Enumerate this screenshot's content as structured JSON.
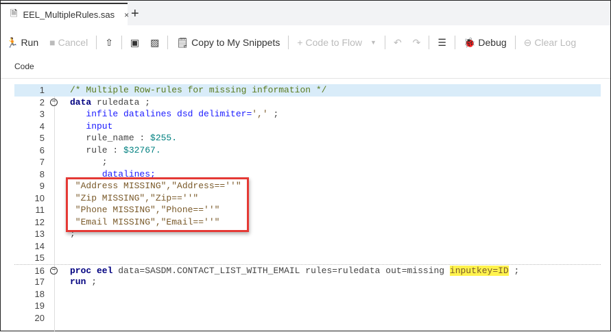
{
  "tab": {
    "title": "EEL_MultipleRules.sas",
    "close": "×",
    "new": "+"
  },
  "toolbar": {
    "run": "Run",
    "cancel": "Cancel",
    "copy_snippets": "Copy to My Snippets",
    "code_to_flow": "Code to Flow",
    "debug": "Debug",
    "clear_log": "Clear Log"
  },
  "code_tab": "Code",
  "lines": [
    [
      [
        "c",
        "/* Multiple Row-rules for missing information */"
      ]
    ],
    [
      [
        "k",
        "data"
      ],
      [
        "p",
        " ruledata ;"
      ]
    ],
    [
      [
        "p",
        "   "
      ],
      [
        "b",
        "infile datalines dsd delimiter="
      ],
      [
        "s",
        "','"
      ],
      [
        "p",
        " ;"
      ]
    ],
    [
      [
        "p",
        "   "
      ],
      [
        "b",
        "input"
      ]
    ],
    [
      [
        "p",
        "   rule_name : "
      ],
      [
        "n",
        "$255."
      ]
    ],
    [
      [
        "p",
        "   rule : "
      ],
      [
        "n",
        "$32767."
      ]
    ],
    [
      [
        "p",
        "      ;"
      ]
    ],
    [
      [
        "p",
        "      "
      ],
      [
        "b",
        "datalines;"
      ]
    ],
    [
      [
        "s",
        " \"Address MISSING\",\"Address==''\""
      ]
    ],
    [
      [
        "s",
        " \"Zip MISSING\",\"Zip==''\""
      ]
    ],
    [
      [
        "s",
        " \"Phone MISSING\",\"Phone==''\""
      ]
    ],
    [
      [
        "s",
        " \"Email MISSING\",\"Email==''\""
      ]
    ],
    [
      [
        "p",
        ";"
      ]
    ],
    [],
    [],
    [
      [
        "k",
        "proc eel"
      ],
      [
        "p",
        " data=SASDM.CONTACT_LIST_WITH_EMAIL rules=ruledata out=missing "
      ],
      [
        "h",
        "inputkey=ID"
      ],
      [
        "p",
        " ;"
      ]
    ],
    [
      [
        "k",
        "run"
      ],
      [
        "p",
        " ;"
      ]
    ],
    [],
    [],
    []
  ],
  "fold_lines": [
    2,
    16
  ]
}
